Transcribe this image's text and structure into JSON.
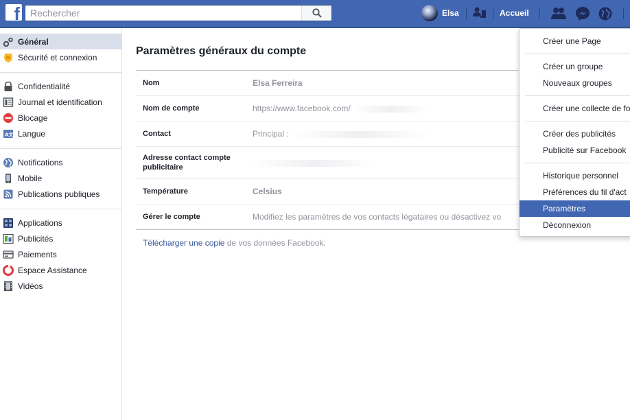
{
  "topbar": {
    "search_placeholder": "Rechercher",
    "profile_name": "Elsa",
    "home_label": "Accueil"
  },
  "sidebar": {
    "groups": [
      [
        {
          "label": "Général",
          "icon": "gear-icon",
          "active": true
        },
        {
          "label": "Sécurité et connexion",
          "icon": "badge-icon"
        }
      ],
      [
        {
          "label": "Confidentialité",
          "icon": "lock-icon"
        },
        {
          "label": "Journal et identification",
          "icon": "timeline-icon"
        },
        {
          "label": "Blocage",
          "icon": "block-icon"
        },
        {
          "label": "Langue",
          "icon": "language-icon"
        }
      ],
      [
        {
          "label": "Notifications",
          "icon": "globe-icon"
        },
        {
          "label": "Mobile",
          "icon": "mobile-icon"
        },
        {
          "label": "Publications publiques",
          "icon": "rss-icon"
        }
      ],
      [
        {
          "label": "Applications",
          "icon": "apps-icon"
        },
        {
          "label": "Publicités",
          "icon": "ads-icon"
        },
        {
          "label": "Paiements",
          "icon": "card-icon"
        },
        {
          "label": "Espace Assistance",
          "icon": "lifebuoy-icon"
        },
        {
          "label": "Vidéos",
          "icon": "film-icon"
        }
      ]
    ]
  },
  "main": {
    "title": "Paramètres généraux du compte",
    "rows": [
      {
        "label": "Nom",
        "value": "Elsa Ferreira"
      },
      {
        "label": "Nom de compte",
        "value": "https://www.facebook.com/"
      },
      {
        "label": "Contact",
        "value": "Principal :"
      },
      {
        "label": "Adresse contact compte publicitaire",
        "value": ""
      },
      {
        "label": "Température",
        "value": "Celsius"
      },
      {
        "label": "Gérer le compte",
        "value": "Modifiez les paramètres de vos contacts légataires ou désactivez vo"
      }
    ],
    "download_link": "Télécharger une copie",
    "download_rest": " de vos données Facebook."
  },
  "menu": {
    "groups": [
      [
        "Créer une Page"
      ],
      [
        "Créer un groupe",
        "Nouveaux groupes"
      ],
      [
        "Créer une collecte de fo"
      ],
      [
        "Créer des publicités",
        "Publicité sur Facebook"
      ],
      [
        "Historique personnel",
        "Préférences du fil d'act",
        "Paramètres",
        "Déconnexion"
      ]
    ],
    "active": "Paramètres"
  },
  "colors": {
    "brand": "#4267b2",
    "link": "#365899",
    "active_nav": "#d8dfea"
  }
}
